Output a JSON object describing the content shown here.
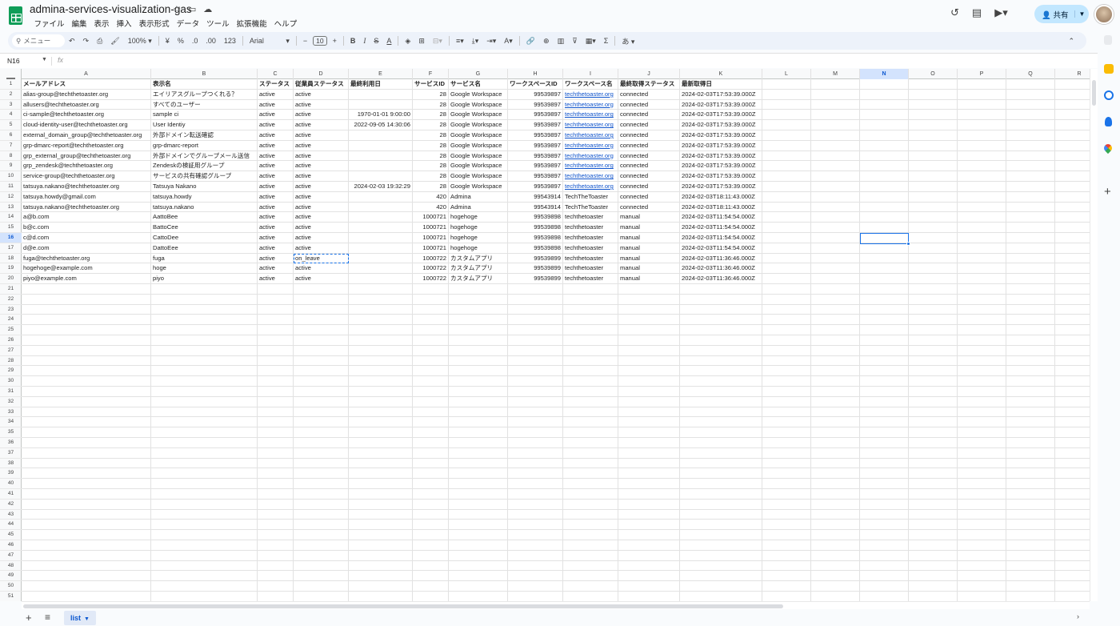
{
  "doc": {
    "title": "admina-services-visualization-gas",
    "menu": [
      "ファイル",
      "編集",
      "表示",
      "挿入",
      "表示形式",
      "データ",
      "ツール",
      "拡張機能",
      "ヘルプ"
    ]
  },
  "header": {
    "share_label": "共有"
  },
  "toolbar": {
    "search_label": "メニュー",
    "zoom": "100%",
    "currency": "¥",
    "percent": "%",
    "dec_decrease": ".0",
    "dec_increase": ".00",
    "format_123": "123",
    "font": "Arial",
    "font_size": "10",
    "bold": "B",
    "italic": "I",
    "strike": "S",
    "text_color": "A",
    "sum": "Σ",
    "input_tool": "あ"
  },
  "formula_bar": {
    "cell_ref": "N16",
    "fx": "fx"
  },
  "columns": [
    "A",
    "B",
    "C",
    "D",
    "E",
    "F",
    "G",
    "H",
    "I",
    "J",
    "K",
    "L",
    "M",
    "N",
    "O",
    "P",
    "Q",
    "R"
  ],
  "selected_column": "N",
  "selected_row": 16,
  "table": {
    "headers": [
      "メールアドレス",
      "表示名",
      "ステータス",
      "従業員ステータス",
      "最終利用日",
      "サービスID",
      "サービス名",
      "ワークスペースID",
      "ワークスペース名",
      "最終取得ステータス",
      "最新取得日"
    ],
    "rows": [
      [
        "alias-group@techthetoaster.org",
        "エイリアスグループつくれる？",
        "active",
        "active",
        "",
        "28",
        "Google Workspace",
        "99539897",
        "techthetoaster.org",
        "connected",
        "2024-02-03T17:53:39.000Z"
      ],
      [
        "allusers@techthetoaster.org",
        "すべてのユーザー",
        "active",
        "active",
        "",
        "28",
        "Google Workspace",
        "99539897",
        "techthetoaster.org",
        "connected",
        "2024-02-03T17:53:39.000Z"
      ],
      [
        "ci-sample@techthetoaster.org",
        "sample ci",
        "active",
        "active",
        "1970-01-01 9:00:00",
        "28",
        "Google Workspace",
        "99539897",
        "techthetoaster.org",
        "connected",
        "2024-02-03T17:53:39.000Z"
      ],
      [
        "cloud-identity-user@techthetoaster.org",
        "User Identiy",
        "active",
        "active",
        "2022-09-05 14:30:06",
        "28",
        "Google Workspace",
        "99539897",
        "techthetoaster.org",
        "connected",
        "2024-02-03T17:53:39.000Z"
      ],
      [
        "external_domain_group@techthetoaster.org",
        "外部ドメイン転送確認",
        "active",
        "active",
        "",
        "28",
        "Google Workspace",
        "99539897",
        "techthetoaster.org",
        "connected",
        "2024-02-03T17:53:39.000Z"
      ],
      [
        "grp-dmarc-report@techthetoaster.org",
        "grp-dmarc-report",
        "active",
        "active",
        "",
        "28",
        "Google Workspace",
        "99539897",
        "techthetoaster.org",
        "connected",
        "2024-02-03T17:53:39.000Z"
      ],
      [
        "grp_external_group@techthetoaster.org",
        "外部ドメインでグループメール送信",
        "active",
        "active",
        "",
        "28",
        "Google Workspace",
        "99539897",
        "techthetoaster.org",
        "connected",
        "2024-02-03T17:53:39.000Z"
      ],
      [
        "grp_zendesk@techthetoaster.org",
        "Zendeskの検証用グループ",
        "active",
        "active",
        "",
        "28",
        "Google Workspace",
        "99539897",
        "techthetoaster.org",
        "connected",
        "2024-02-03T17:53:39.000Z"
      ],
      [
        "service-group@techthetoaster.org",
        "サービスの共有確認グループ",
        "active",
        "active",
        "",
        "28",
        "Google Workspace",
        "99539897",
        "techthetoaster.org",
        "connected",
        "2024-02-03T17:53:39.000Z"
      ],
      [
        "tatsuya.nakano@techthetoaster.org",
        "Tatsuya Nakano",
        "active",
        "active",
        "2024-02-03 19:32:29",
        "28",
        "Google Workspace",
        "99539897",
        "techthetoaster.org",
        "connected",
        "2024-02-03T17:53:39.000Z"
      ],
      [
        "tatsuya.howdy@gmail.com",
        "tatsuya.howdy",
        "active",
        "active",
        "",
        "420",
        "Admina",
        "99543914",
        "TechTheToaster",
        "connected",
        "2024-02-03T18:11:43.000Z"
      ],
      [
        "tatsuya.nakano@techthetoaster.org",
        "tatsuya.nakano",
        "active",
        "active",
        "",
        "420",
        "Admina",
        "99543914",
        "TechTheToaster",
        "connected",
        "2024-02-03T18:11:43.000Z"
      ],
      [
        "a@b.com",
        "AattoBee",
        "active",
        "active",
        "",
        "1000721",
        "hogehoge",
        "99539898",
        "techthetoaster",
        "manual",
        "2024-02-03T11:54:54.000Z"
      ],
      [
        "b@c.com",
        "BattoCee",
        "active",
        "active",
        "",
        "1000721",
        "hogehoge",
        "99539898",
        "techthetoaster",
        "manual",
        "2024-02-03T11:54:54.000Z"
      ],
      [
        "c@d.com",
        "CattoDee",
        "active",
        "active",
        "",
        "1000721",
        "hogehoge",
        "99539898",
        "techthetoaster",
        "manual",
        "2024-02-03T11:54:54.000Z"
      ],
      [
        "d@e.com",
        "DattoEee",
        "active",
        "active",
        "",
        "1000721",
        "hogehoge",
        "99539898",
        "techthetoaster",
        "manual",
        "2024-02-03T11:54:54.000Z"
      ],
      [
        "fuga@techthetoaster.org",
        "fuga",
        "active",
        "on_leave",
        "",
        "1000722",
        "カスタムアプリ",
        "99539899",
        "techthetoaster",
        "manual",
        "2024-02-03T11:36:46.000Z"
      ],
      [
        "hogehoge@example.com",
        "hoge",
        "active",
        "active",
        "",
        "1000722",
        "カスタムアプリ",
        "99539899",
        "techthetoaster",
        "manual",
        "2024-02-03T11:36:46.000Z"
      ],
      [
        "piyo@example.com",
        "piyo",
        "active",
        "active",
        "",
        "1000722",
        "カスタムアプリ",
        "99539899",
        "techthetoaster",
        "manual",
        "2024-02-03T11:36:46.000Z"
      ]
    ]
  },
  "sheet_tabs": {
    "active": "list"
  }
}
